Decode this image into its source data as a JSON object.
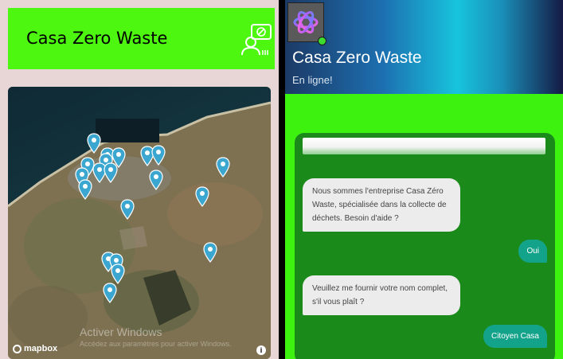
{
  "left_app": {
    "title": "Casa Zero Waste",
    "header_icon": "support-agent-icon"
  },
  "map": {
    "provider_logo": "mapbox",
    "watermark_title": "Activer Windows",
    "watermark_subtitle": "Accédez aux paramètres pour activer Windows.",
    "info_icon": "info-icon",
    "marker_icon": "map-pin-icon",
    "marker_color": "#3ba7d0"
  },
  "chat": {
    "bot_name": "Casa Zero Waste",
    "status": "En ligne!",
    "status_color": "#3ddc2e",
    "avatar_icon": "openai-logo-icon",
    "messages": [
      {
        "from": "bot",
        "text": "Nous sommes l'entreprise Casa Zéro Waste, spécialisée dans la collecte de déchets. Besoin d'aide ?"
      },
      {
        "from": "user",
        "text": "Oui"
      },
      {
        "from": "bot",
        "text": "Veuillez me fournir votre nom complet, s'il vous plaît ?"
      },
      {
        "from": "user",
        "text": "Citoyen Casa"
      }
    ]
  },
  "colors": {
    "accent_green": "#4df70f",
    "chat_panel_green": "#1a8a1a",
    "user_bubble": "#13a38a"
  }
}
